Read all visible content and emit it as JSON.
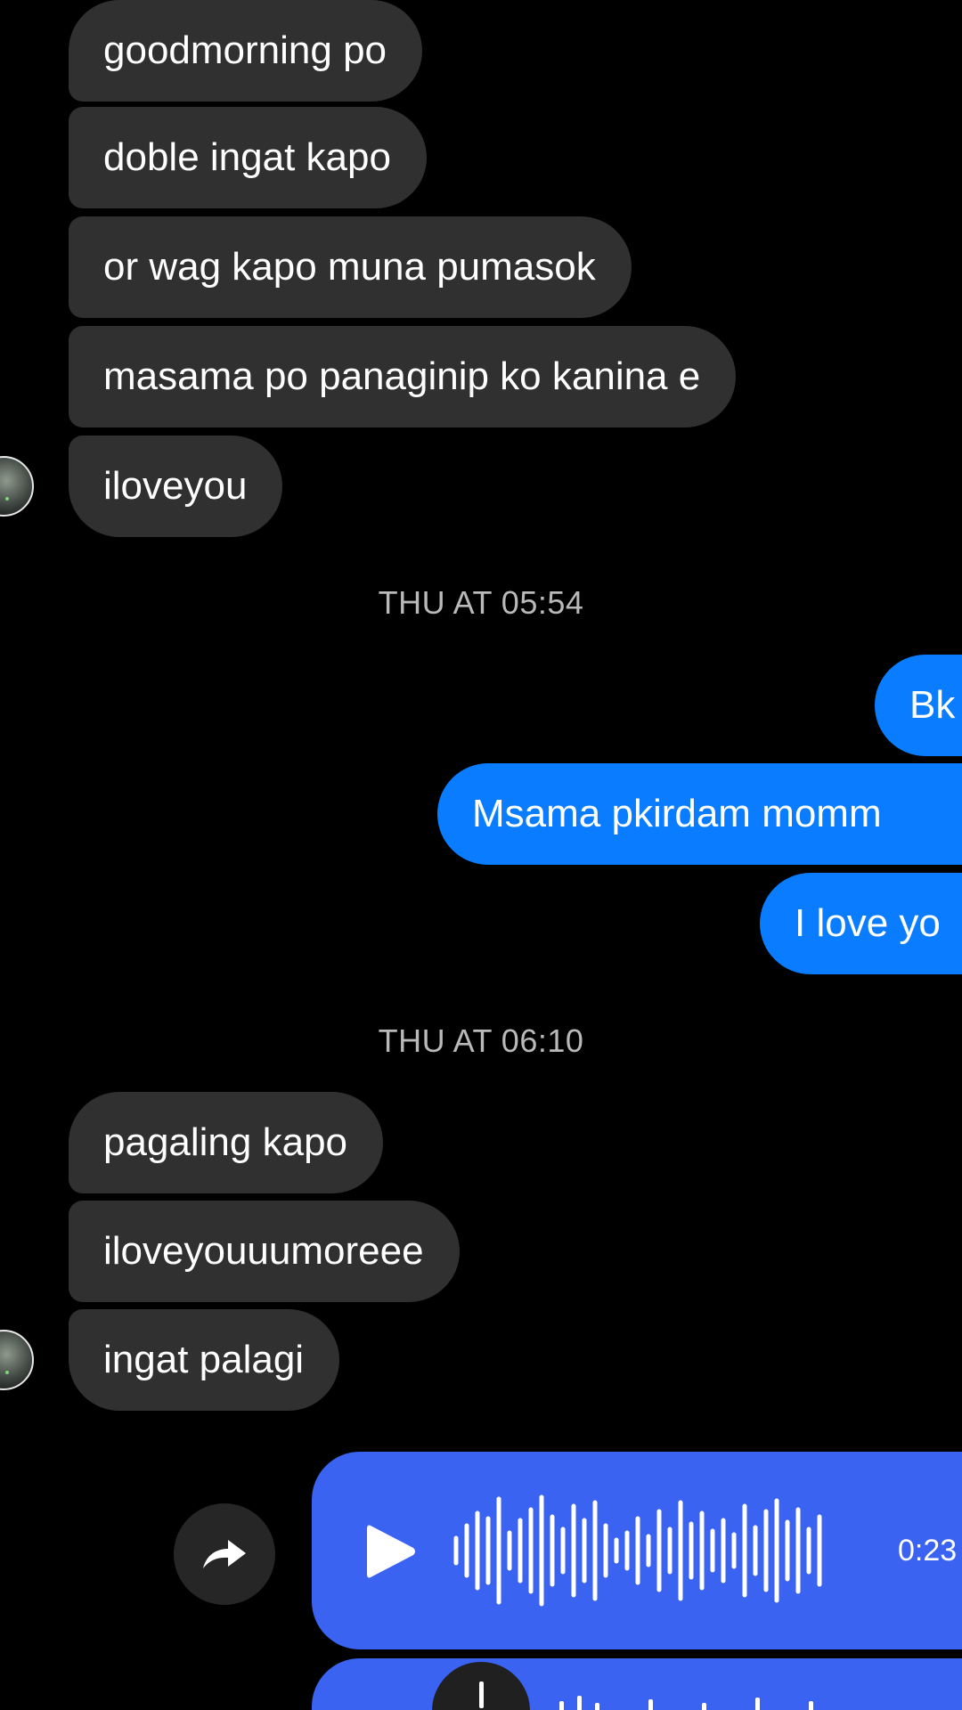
{
  "thread": {
    "group1_incoming": [
      "goodmorning po",
      "doble ingat kapo",
      "or wag kapo muna pumasok",
      "masama po panaginip ko kanina e",
      "iloveyou"
    ],
    "timestamp1": "THU AT 05:54",
    "group2_outgoing": [
      "Bk",
      "Msama pkirdam momm",
      "I love yo"
    ],
    "timestamp2": "THU AT 06:10",
    "group3_incoming": [
      "pagaling kapo",
      "iloveyouuumoreee",
      "ingat palagi"
    ],
    "voice_message": {
      "duration": "0:23"
    }
  },
  "icons": {
    "avatar": "contact-avatar",
    "share": "share-arrow-icon",
    "play": "play-icon",
    "waveform": "audio-waveform-icon"
  },
  "colors": {
    "background": "#000000",
    "incoming_bubble": "#303030",
    "outgoing_bubble": "#0a7cff",
    "voice_bubble": "#3a63f2",
    "timestamp_text": "#b9b9b9"
  }
}
